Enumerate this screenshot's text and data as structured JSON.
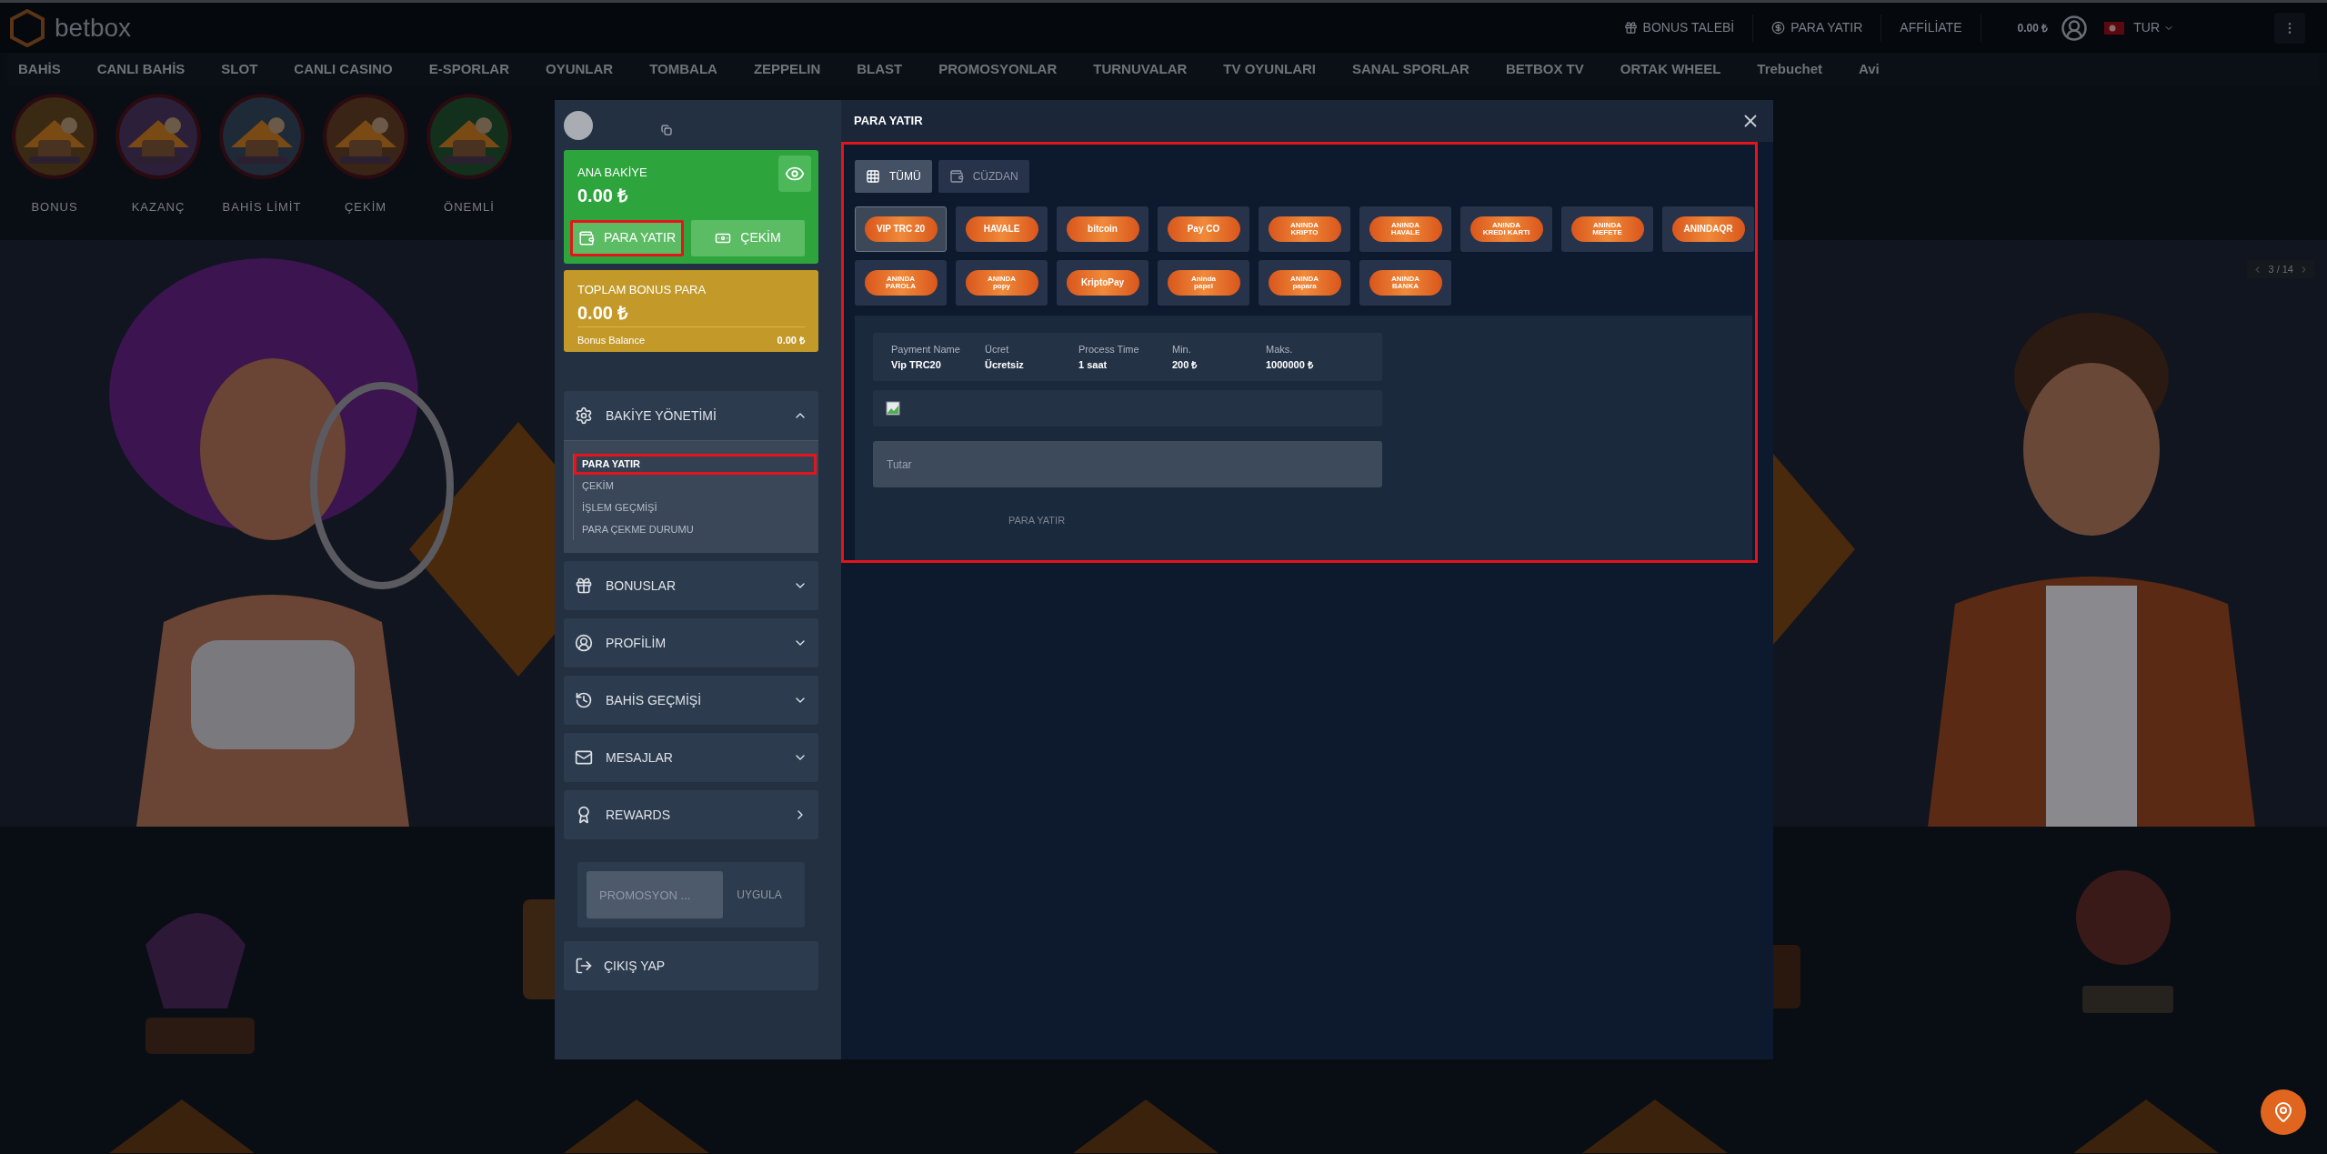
{
  "header": {
    "logo": "betbox",
    "links": [
      {
        "label": "BONUS TALEBİ"
      },
      {
        "label": "PARA YATIR"
      },
      {
        "label": "AFFİLİATE"
      }
    ],
    "balance": "0.00 ₺",
    "language": "TUR"
  },
  "nav": [
    "BAHİS",
    "CANLI BAHİS",
    "SLOT",
    "CANLI CASINO",
    "E-SPORLAR",
    "OYUNLAR",
    "TOMBALA",
    "ZEPPELIN",
    "BLAST",
    "PROMOSYONLAR",
    "TURNUVALAR",
    "TV OYUNLARI",
    "SANAL SPORLAR",
    "BETBOX TV",
    "ORTAK WHEEL",
    "Trebuchet",
    "Avi"
  ],
  "stories": [
    {
      "label": "BONUS"
    },
    {
      "label": "KAZANÇ"
    },
    {
      "label": "BAHİS LİMİT"
    },
    {
      "label": "ÇEKİM"
    },
    {
      "label": "ÖNEMLİ"
    }
  ],
  "banner": {
    "counter": "3 / 14"
  },
  "modal": {
    "title": "PARA YATIR",
    "wallet": {
      "title": "ANA BAKİYE",
      "amount": "0.00 ₺",
      "actions": [
        {
          "label": "PARA YATIR",
          "kind": "deposit",
          "highlighted": true
        },
        {
          "label": "ÇEKİM",
          "kind": "withdraw",
          "highlighted": false
        }
      ]
    },
    "bonus": {
      "title": "TOPLAM BONUS PARA",
      "amount": "0.00 ₺",
      "balance_label": "Bonus Balance",
      "balance": "0.00 ₺"
    },
    "menu": [
      {
        "label": "BAKİYE YÖNETİMİ",
        "kind": "balance",
        "expanded": true,
        "children": [
          {
            "label": "PARA YATIR",
            "selected": true,
            "highlighted": true
          },
          {
            "label": "ÇEKİM",
            "selected": false,
            "highlighted": false
          },
          {
            "label": "İŞLEM GEÇMİŞİ",
            "selected": false,
            "highlighted": false
          },
          {
            "label": "PARA ÇEKME DURUMU",
            "selected": false,
            "highlighted": false
          }
        ]
      },
      {
        "label": "BONUSLAR",
        "kind": "bonuses",
        "expanded": false
      },
      {
        "label": "PROFİLİM",
        "kind": "profile",
        "expanded": false
      },
      {
        "label": "BAHİS GEÇMİŞİ",
        "kind": "history",
        "expanded": false
      },
      {
        "label": "MESAJLAR",
        "kind": "messages",
        "expanded": false
      },
      {
        "label": "REWARDS",
        "kind": "rewards"
      }
    ],
    "promo": {
      "placeholder": "PROMOSYON ...",
      "button": "UYGULA"
    },
    "logout": "ÇIKIŞ YAP",
    "panel": {
      "highlighted": true,
      "tabs": [
        {
          "label": "TÜMÜ",
          "selected": true
        },
        {
          "label": "CÜZDAN",
          "selected": false
        }
      ],
      "methods": [
        {
          "label": "VIP TRC 20",
          "selected": true
        },
        {
          "label": "HAVALE",
          "selected": false
        },
        {
          "label": "bitcoin",
          "selected": false
        },
        {
          "label": "Pay CO",
          "selected": false
        },
        {
          "label": "ANINDA",
          "sub": "KRIPTO",
          "selected": false
        },
        {
          "label": "ANINDA",
          "sub": "HAVALE",
          "selected": false
        },
        {
          "label": "ANINDA",
          "sub": "KREDI KARTI",
          "selected": false
        },
        {
          "label": "ANINDA",
          "sub": "MEFETE",
          "selected": false
        },
        {
          "label": "ANINDAQR",
          "selected": false
        },
        {
          "label": "ANINDA",
          "sub": "PAROLA",
          "selected": false
        },
        {
          "label": "ANINDA",
          "sub": "popy",
          "selected": false
        },
        {
          "label": "KriptoPay",
          "selected": false
        },
        {
          "label": "Aninda",
          "sub": "papel",
          "selected": false
        },
        {
          "label": "ANINDA",
          "sub": "papara",
          "selected": false
        },
        {
          "label": "ANINDA",
          "sub": "BANKA",
          "selected": false
        }
      ],
      "details": {
        "columns": [
          "Payment Name",
          "Ücret",
          "Process Time",
          "Min.",
          "Maks."
        ],
        "values": [
          "Vip TRC20",
          "Ücretsiz",
          "1 saat",
          "200 ₺",
          "1000000 ₺"
        ]
      },
      "amount_placeholder": "Tutar",
      "submit": "PARA YATIR"
    }
  }
}
